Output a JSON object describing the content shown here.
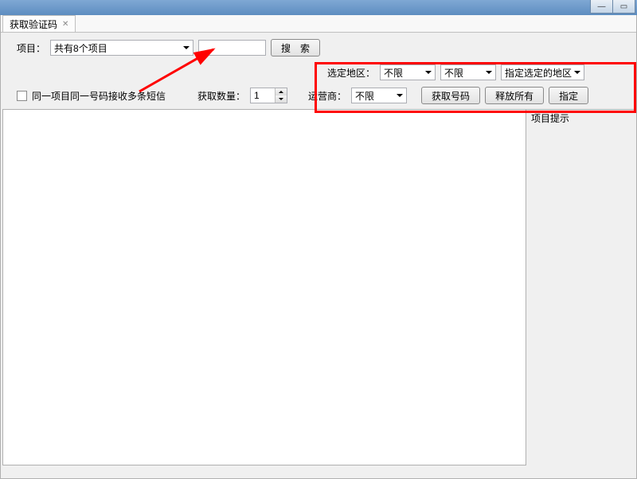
{
  "tab": {
    "title": "获取验证码"
  },
  "toolbar": {
    "project_label": "项目：",
    "project_value": "共有8个项目",
    "search_btn": "搜　索"
  },
  "region": {
    "label": "选定地区：",
    "province": "不限",
    "city": "不限",
    "scope": "指定选定的地区"
  },
  "row2": {
    "checkbox_label": "同一项目同一号码接收多条短信",
    "count_label": "获取数量：",
    "count_value": "1",
    "carrier_label": "运营商：",
    "carrier_value": "不限",
    "get_btn": "获取号码",
    "release_btn": "释放所有",
    "assign_btn": "指定"
  },
  "side": {
    "hint_label": "项目提示"
  }
}
